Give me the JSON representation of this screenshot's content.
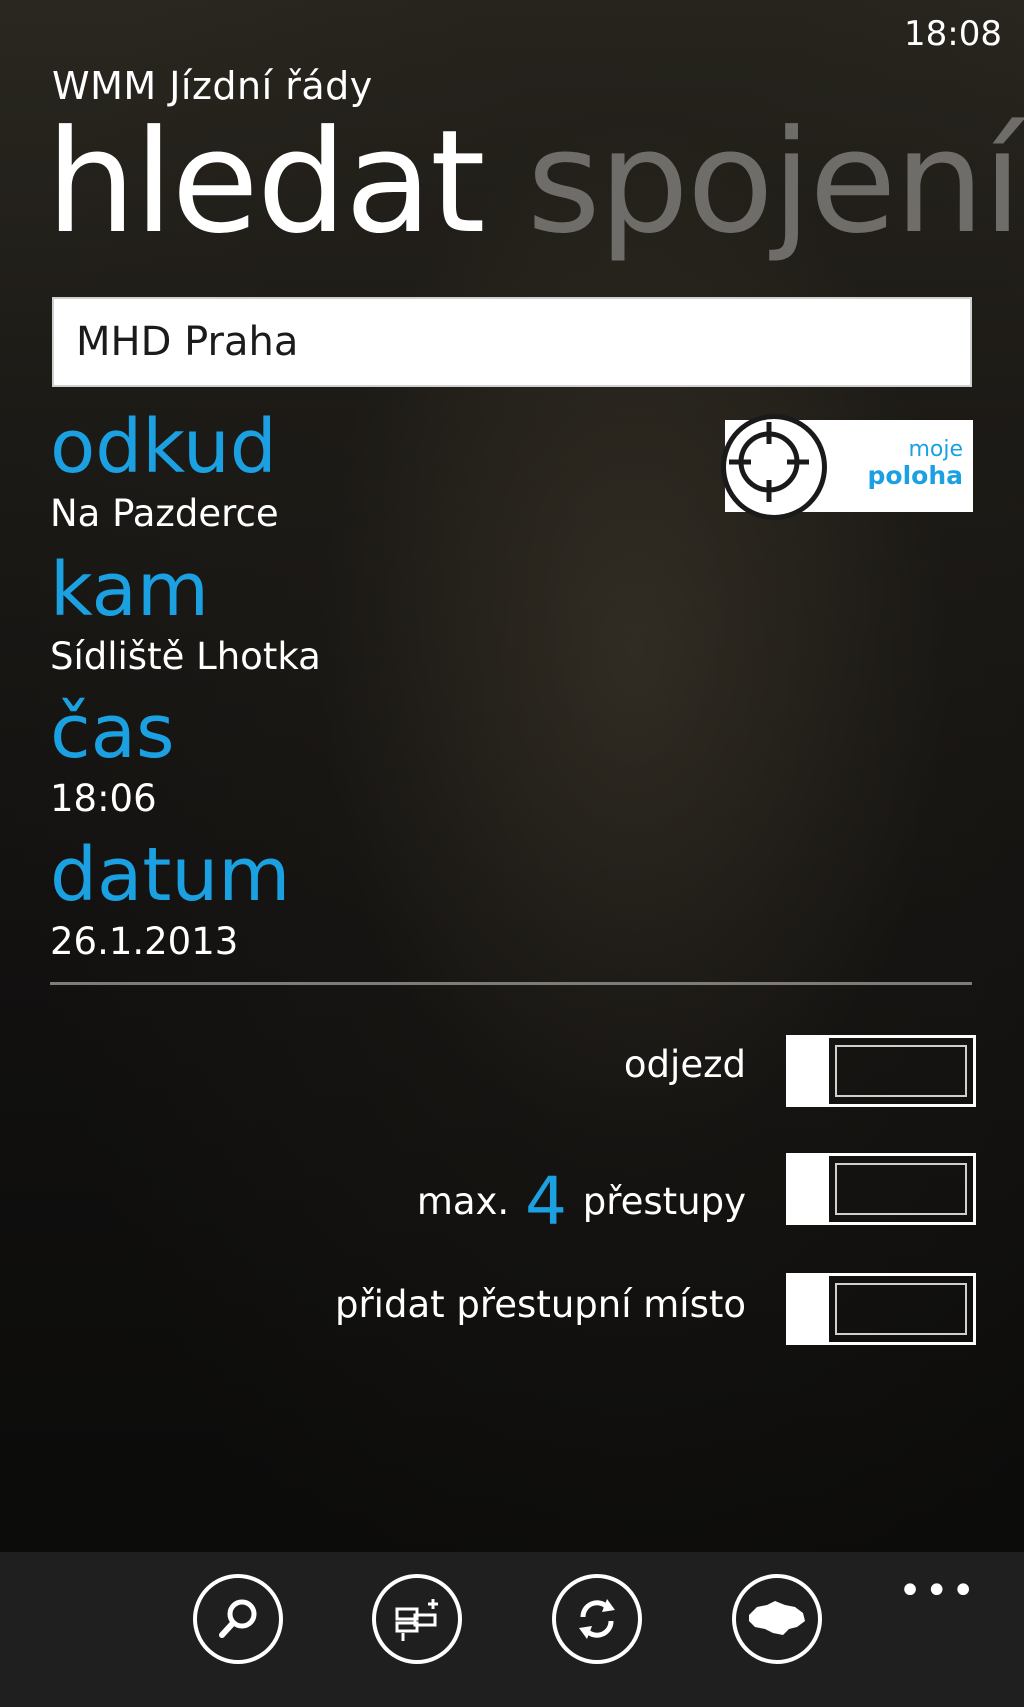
{
  "status": {
    "time": "18:08"
  },
  "app_title": "WMM Jízdní řády",
  "pivot": {
    "active": "hledat",
    "inactive": "spojení"
  },
  "region": {
    "value": "MHD Praha"
  },
  "fields": {
    "from": {
      "label": "odkud",
      "value": "Na Pazderce"
    },
    "to": {
      "label": "kam",
      "value": "Sídliště Lhotka"
    },
    "time": {
      "label": "čas",
      "value": "18:06"
    },
    "date": {
      "label": "datum",
      "value": "26.1.2013"
    }
  },
  "location_button": {
    "line1": "moje",
    "line2": "poloha"
  },
  "options": {
    "departure": {
      "label": "odjezd",
      "state": "off"
    },
    "transfers": {
      "prefix": "max.",
      "count": "4",
      "suffix": "přestupy",
      "state": "off"
    },
    "add_transfer": {
      "label": "přidat přestupní místo",
      "state": "off"
    }
  },
  "appbar": {
    "buttons": [
      "search-icon",
      "favorites-icon",
      "swap-icon",
      "region-map-icon"
    ],
    "more": "•••"
  },
  "colors": {
    "accent": "#1ba1e2",
    "background": "#0c0b09",
    "appbar": "#1f1f1f"
  }
}
